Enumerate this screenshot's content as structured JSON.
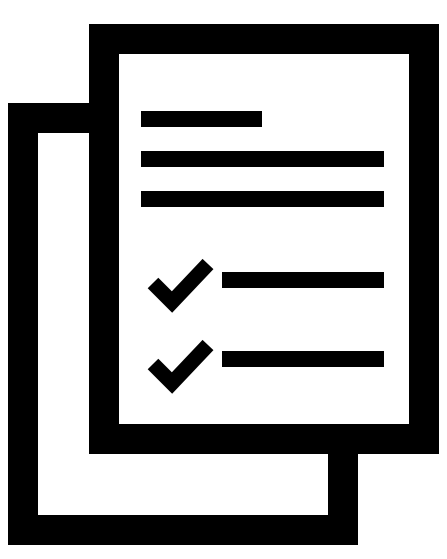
{
  "icon": {
    "name": "document-checklist-icon",
    "stroke_color": "#000000",
    "fill_color": "#ffffff",
    "checked_items": 2,
    "text_lines": 3
  }
}
